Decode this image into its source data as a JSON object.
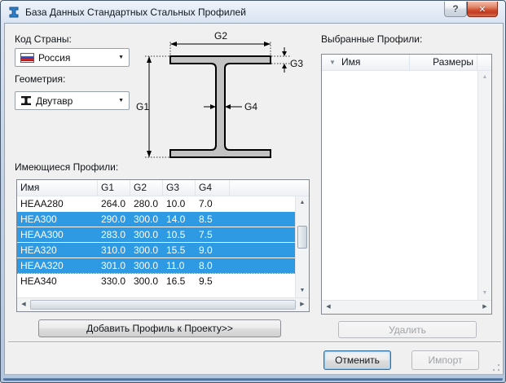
{
  "window": {
    "title": "База Данных Стандартных Стальных Профилей"
  },
  "icons": {
    "help": "?",
    "close": "✕",
    "dropdown_arrow": "▼",
    "sort_arrow": "▼",
    "scroll_up": "▲",
    "scroll_down": "▼",
    "scroll_left": "◀",
    "scroll_right": "▶"
  },
  "left_panel": {
    "country_label": "Код Страны:",
    "country_value": "Россия",
    "geometry_label": "Геометрия:",
    "geometry_value": "Двутавр"
  },
  "diagram": {
    "g1": "G1",
    "g2": "G2",
    "g3": "G3",
    "g4": "G4"
  },
  "available": {
    "label": "Имеющиеся Профили:",
    "columns": [
      "Имя",
      "G1",
      "G2",
      "G3",
      "G4"
    ],
    "rows": [
      {
        "name": "HEAA280",
        "g1": "264.0",
        "g2": "280.0",
        "g3": "10.0",
        "g4": "7.0",
        "selected": false,
        "focused": false
      },
      {
        "name": "HEA300",
        "g1": "290.0",
        "g2": "300.0",
        "g3": "14.0",
        "g4": "8.5",
        "selected": true,
        "focused": false
      },
      {
        "name": "HEAA300",
        "g1": "283.0",
        "g2": "300.0",
        "g3": "10.5",
        "g4": "7.5",
        "selected": true,
        "focused": false
      },
      {
        "name": "HEA320",
        "g1": "310.0",
        "g2": "300.0",
        "g3": "15.5",
        "g4": "9.0",
        "selected": true,
        "focused": false
      },
      {
        "name": "HEAA320",
        "g1": "301.0",
        "g2": "300.0",
        "g3": "11.0",
        "g4": "8.0",
        "selected": true,
        "focused": true
      },
      {
        "name": "HEA340",
        "g1": "330.0",
        "g2": "300.0",
        "g3": "16.5",
        "g4": "9.5",
        "selected": false,
        "focused": false
      }
    ]
  },
  "selected_panel": {
    "label": "Выбранные Профили:",
    "columns": [
      "Имя",
      "Размеры"
    ],
    "rows": []
  },
  "buttons": {
    "add": "Добавить Профиль к Проекту>>",
    "delete": "Удалить",
    "cancel": "Отменить",
    "import": "Импорт"
  },
  "colors": {
    "selection": "#2d9ae3",
    "close_button": "#cf4a2c",
    "frame": "#b4c6dc",
    "client_bg": "#f0f0f0"
  }
}
